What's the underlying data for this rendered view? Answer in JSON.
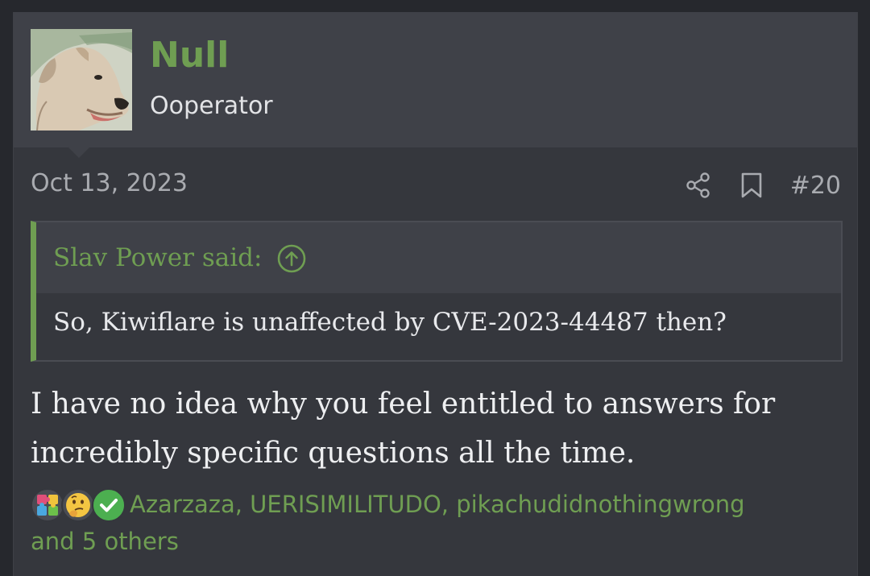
{
  "user": {
    "name": "Null",
    "title": "Ooperator"
  },
  "post": {
    "date": "Oct 13, 2023",
    "number": "#20",
    "text": "I have no idea why you feel entitled to answers for incredibly specific questions all the time."
  },
  "quote": {
    "author_label": "Slav Power said:",
    "body": "So, Kiwiflare is unaffected by CVE-2023-44487 then?"
  },
  "reactions": {
    "names": "Azarzaza, UERISIMILITUDO, pikachudidnothingwrong",
    "others": "and 5 others",
    "icons": [
      "puzzle-icon",
      "thinking-face-icon",
      "checkmark-icon"
    ]
  },
  "colors": {
    "accent": "#6f9e52",
    "background": "#35373d",
    "header_background": "#3f4148",
    "text": "#eeeff1",
    "muted": "#a9abb0"
  },
  "icons": {
    "share": "share-icon",
    "bookmark": "bookmark-icon",
    "quote_jump": "arrow-up-circle-icon"
  }
}
